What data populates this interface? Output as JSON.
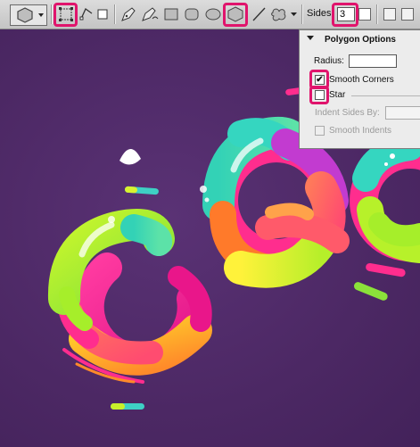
{
  "toolbar": {
    "tools": [
      {
        "name": "shape-layers-icon"
      },
      {
        "name": "paths-icon"
      },
      {
        "name": "fill-pixels-icon"
      },
      {
        "name": "pen-icon"
      },
      {
        "name": "freeform-pen-icon"
      },
      {
        "name": "rectangle-icon"
      },
      {
        "name": "rounded-rectangle-icon"
      },
      {
        "name": "ellipse-icon"
      },
      {
        "name": "polygon-icon"
      },
      {
        "name": "line-icon"
      },
      {
        "name": "custom-shape-icon"
      }
    ],
    "sides_label": "Sides:",
    "sides_value": "3",
    "highlight_color": "#e0146c"
  },
  "polygon_options": {
    "title": "Polygon Options",
    "radius_label": "Radius:",
    "radius_value": "",
    "smooth_corners_label": "Smooth Corners",
    "smooth_corners_checked": true,
    "star_label": "Star",
    "star_checked": false,
    "indent_label": "Indent Sides By:",
    "indent_value": "",
    "smooth_indents_label": "Smooth Indents",
    "smooth_indents_checked": false
  },
  "canvas": {
    "background": "#4e2a66",
    "colors": [
      "#b7f12a",
      "#35d6c0",
      "#ff2d8e",
      "#ff6a5a",
      "#ffd21e",
      "#c23bd0"
    ]
  }
}
